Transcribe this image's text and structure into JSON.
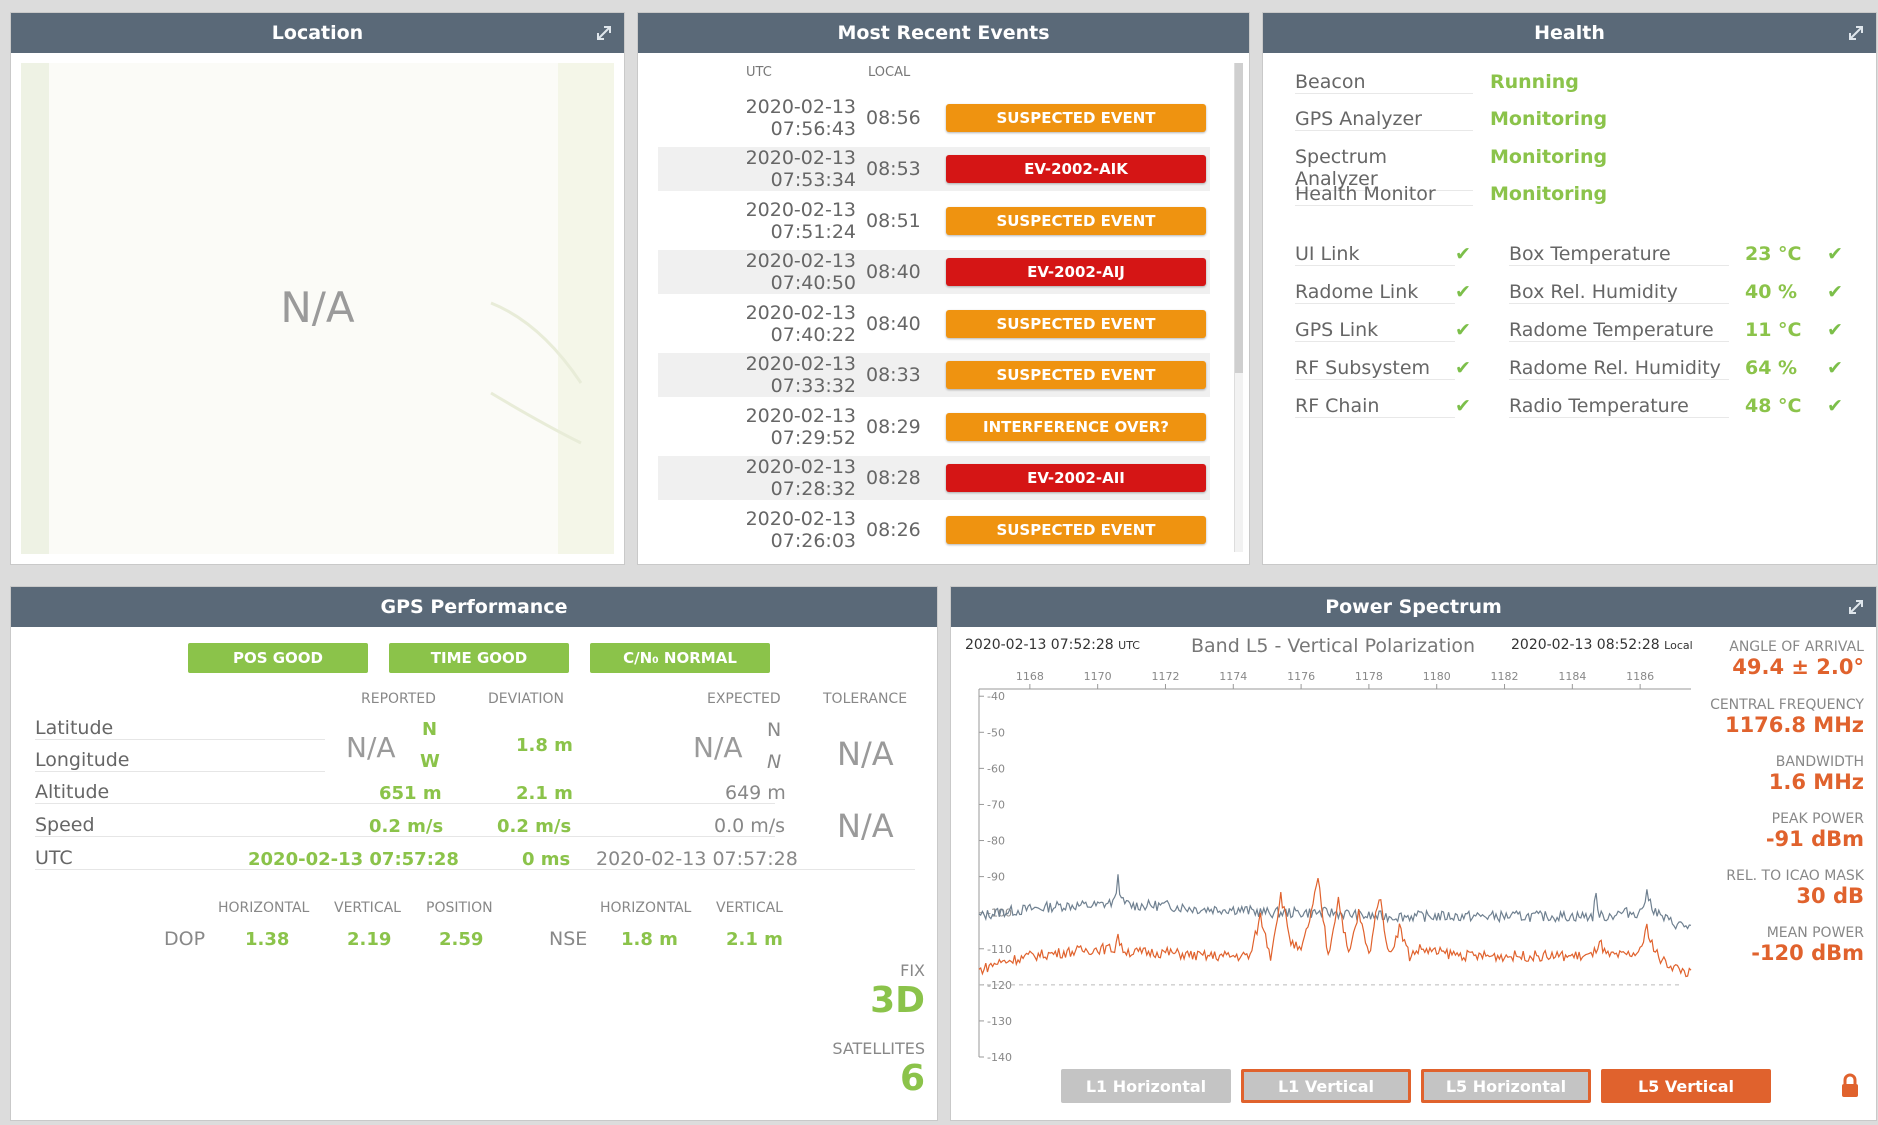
{
  "location": {
    "title": "Location",
    "na": "N/A"
  },
  "events": {
    "title": "Most Recent Events",
    "col_utc": "UTC",
    "col_local": "LOCAL",
    "rows": [
      {
        "utc": "2020-02-13 07:56:43",
        "local": "08:56",
        "label": "SUSPECTED EVENT",
        "color": "#ef9310"
      },
      {
        "utc": "2020-02-13 07:53:34",
        "local": "08:53",
        "label": "EV-2002-AIK",
        "color": "#d51515"
      },
      {
        "utc": "2020-02-13 07:51:24",
        "local": "08:51",
        "label": "SUSPECTED EVENT",
        "color": "#ef9310"
      },
      {
        "utc": "2020-02-13 07:40:50",
        "local": "08:40",
        "label": "EV-2002-AIJ",
        "color": "#d51515"
      },
      {
        "utc": "2020-02-13 07:40:22",
        "local": "08:40",
        "label": "SUSPECTED EVENT",
        "color": "#ef9310"
      },
      {
        "utc": "2020-02-13 07:33:32",
        "local": "08:33",
        "label": "SUSPECTED EVENT",
        "color": "#ef9310"
      },
      {
        "utc": "2020-02-13 07:29:52",
        "local": "08:29",
        "label": "INTERFERENCE OVER?",
        "color": "#ef9310"
      },
      {
        "utc": "2020-02-13 07:28:32",
        "local": "08:28",
        "label": "EV-2002-AII",
        "color": "#d51515"
      },
      {
        "utc": "2020-02-13 07:26:03",
        "local": "08:26",
        "label": "SUSPECTED EVENT",
        "color": "#ef9310"
      }
    ]
  },
  "health": {
    "title": "Health",
    "services": [
      {
        "name": "Beacon",
        "status": "Running"
      },
      {
        "name": "GPS Analyzer",
        "status": "Monitoring"
      },
      {
        "name": "Spectrum Analyzer",
        "status": "Monitoring"
      },
      {
        "name": "Health Monitor",
        "status": "Monitoring"
      }
    ],
    "links": [
      {
        "name": "UI Link",
        "icon": "check-icon"
      },
      {
        "name": "Radome Link",
        "icon": "check-icon"
      },
      {
        "name": "GPS Link",
        "icon": "check-icon"
      },
      {
        "name": "RF Subsystem",
        "icon": "check-icon"
      },
      {
        "name": "RF Chain",
        "icon": "check-icon"
      }
    ],
    "sensors": [
      {
        "name": "Box Temperature",
        "value": "23 °C"
      },
      {
        "name": "Box Rel. Humidity",
        "value": "40 %"
      },
      {
        "name": "Radome Temperature",
        "value": "11 °C"
      },
      {
        "name": "Radome Rel. Humidity",
        "value": "64 %"
      },
      {
        "name": "Radio Temperature",
        "value": "48 °C"
      }
    ],
    "ok_color": "#8bc34a"
  },
  "gps": {
    "title": "GPS Performance",
    "pills": [
      "POS GOOD",
      "TIME GOOD",
      "C/N₀ NORMAL"
    ],
    "headers": {
      "reported": "REPORTED",
      "deviation": "DEVIATION",
      "expected": "EXPECTED",
      "tolerance": "TOLERANCE"
    },
    "rows": {
      "latitude": {
        "label": "Latitude",
        "reported_dir": "N",
        "expected_dir": "N"
      },
      "longitude": {
        "label": "Longitude",
        "reported_dir": "W",
        "expected_dir": "N"
      },
      "altitude": {
        "label": "Altitude",
        "reported": "651 m",
        "deviation": "2.1 m",
        "expected": "649 m"
      },
      "speed": {
        "label": "Speed",
        "reported": "0.2 m/s",
        "deviation": "0.2 m/s",
        "expected": "0.0 m/s"
      },
      "utc": {
        "label": "UTC",
        "reported": "2020-02-13 07:57:28",
        "deviation": "0 ms",
        "expected": "2020-02-13 07:57:28"
      }
    },
    "position_na": "N/A",
    "position_deviation": "1.8 m",
    "expected_na": "N/A",
    "tolerance_pos": "N/A",
    "tolerance_speed": "N/A",
    "dop": {
      "label": "DOP",
      "h_header": "HORIZONTAL",
      "v_header": "VERTICAL",
      "p_header": "POSITION",
      "horizontal": "1.38",
      "vertical": "2.19",
      "position": "2.59"
    },
    "nse": {
      "label": "NSE",
      "h_header": "HORIZONTAL",
      "v_header": "VERTICAL",
      "horizontal": "1.8 m",
      "vertical": "2.1 m"
    },
    "fix": {
      "label": "FIX",
      "value": "3D"
    },
    "satellites": {
      "label": "SATELLITES",
      "value": "6"
    }
  },
  "spectrum": {
    "title": "Power Spectrum",
    "utc_time": "2020-02-13 07:52:28",
    "utc_suffix": "UTC",
    "band_label": "Band L5 - Vertical Polarization",
    "local_time": "2020-02-13 08:52:28",
    "local_suffix": "Local",
    "metrics": [
      {
        "label": "ANGLE OF ARRIVAL",
        "value": "49.4 ± 2.0°"
      },
      {
        "label": "CENTRAL FREQUENCY",
        "value": "1176.8 MHz"
      },
      {
        "label": "BANDWIDTH",
        "value": "1.6 MHz"
      },
      {
        "label": "PEAK POWER",
        "value": "-91 dBm"
      },
      {
        "label": "REL. TO ICAO MASK",
        "value": "30 dB"
      },
      {
        "label": "MEAN POWER",
        "value": "-120 dBm"
      }
    ],
    "buttons": [
      {
        "label": "L1 Horizontal",
        "state": "disabled"
      },
      {
        "label": "L1 Vertical",
        "state": "outlined"
      },
      {
        "label": "L5 Horizontal",
        "state": "outlined"
      },
      {
        "label": "L5 Vertical",
        "state": "active"
      }
    ],
    "accent_color": "#e0622d"
  },
  "chart_data": {
    "type": "line",
    "title": "Band L5 - Vertical Polarization",
    "xlim": [
      1166.5,
      1187.5
    ],
    "ylim": [
      -140,
      -38
    ],
    "x_ticks": [
      1168,
      1170,
      1172,
      1174,
      1176,
      1178,
      1180,
      1182,
      1184,
      1186
    ],
    "y_ticks": [
      -40,
      -50,
      -60,
      -70,
      -80,
      -90,
      -100,
      -110,
      -120,
      -130,
      -140
    ],
    "mask_level": -120,
    "series": [
      {
        "color": "#6f8090",
        "x": [
          1166.5,
          1167,
          1168,
          1169,
          1170,
          1170.5,
          1170.6,
          1170.7,
          1171,
          1172,
          1173,
          1174,
          1175,
          1176,
          1177,
          1178,
          1179,
          1180,
          1181,
          1182,
          1183,
          1184,
          1184.6,
          1184.7,
          1184.8,
          1185,
          1185.5,
          1186,
          1186.2,
          1186.4,
          1186.6,
          1187,
          1187.5
        ],
        "y": [
          -101,
          -100,
          -99,
          -98,
          -98,
          -97,
          -90,
          -97,
          -98,
          -98,
          -99,
          -99,
          -100,
          -100,
          -100,
          -101,
          -101,
          -101,
          -101,
          -101,
          -101,
          -101,
          -101,
          -95,
          -101,
          -101,
          -100,
          -100,
          -95,
          -99,
          -101,
          -103,
          -104
        ]
      },
      {
        "color": "#e0622d",
        "x": [
          1166.5,
          1167,
          1168,
          1169,
          1170,
          1170.5,
          1170.6,
          1170.7,
          1171,
          1172,
          1173,
          1174,
          1174.5,
          1174.8,
          1175.1,
          1175.4,
          1175.7,
          1176,
          1176.3,
          1176.5,
          1176.8,
          1177.1,
          1177.4,
          1177.7,
          1178,
          1178.3,
          1178.6,
          1178.9,
          1179.2,
          1179.5,
          1180,
          1181,
          1182,
          1183,
          1184,
          1184.6,
          1184.8,
          1185,
          1185.5,
          1186,
          1186.2,
          1186.4,
          1186.6,
          1187,
          1187.5
        ],
        "y": [
          -116,
          -114,
          -112,
          -111,
          -110,
          -110,
          -106,
          -110,
          -111,
          -111,
          -112,
          -112,
          -112,
          -101,
          -112,
          -95,
          -108,
          -111,
          -100,
          -91,
          -112,
          -96,
          -112,
          -100,
          -112,
          -95,
          -112,
          -104,
          -112,
          -110,
          -111,
          -112,
          -112,
          -112,
          -112,
          -112,
          -108,
          -112,
          -112,
          -111,
          -104,
          -110,
          -113,
          -115,
          -117
        ]
      }
    ]
  }
}
